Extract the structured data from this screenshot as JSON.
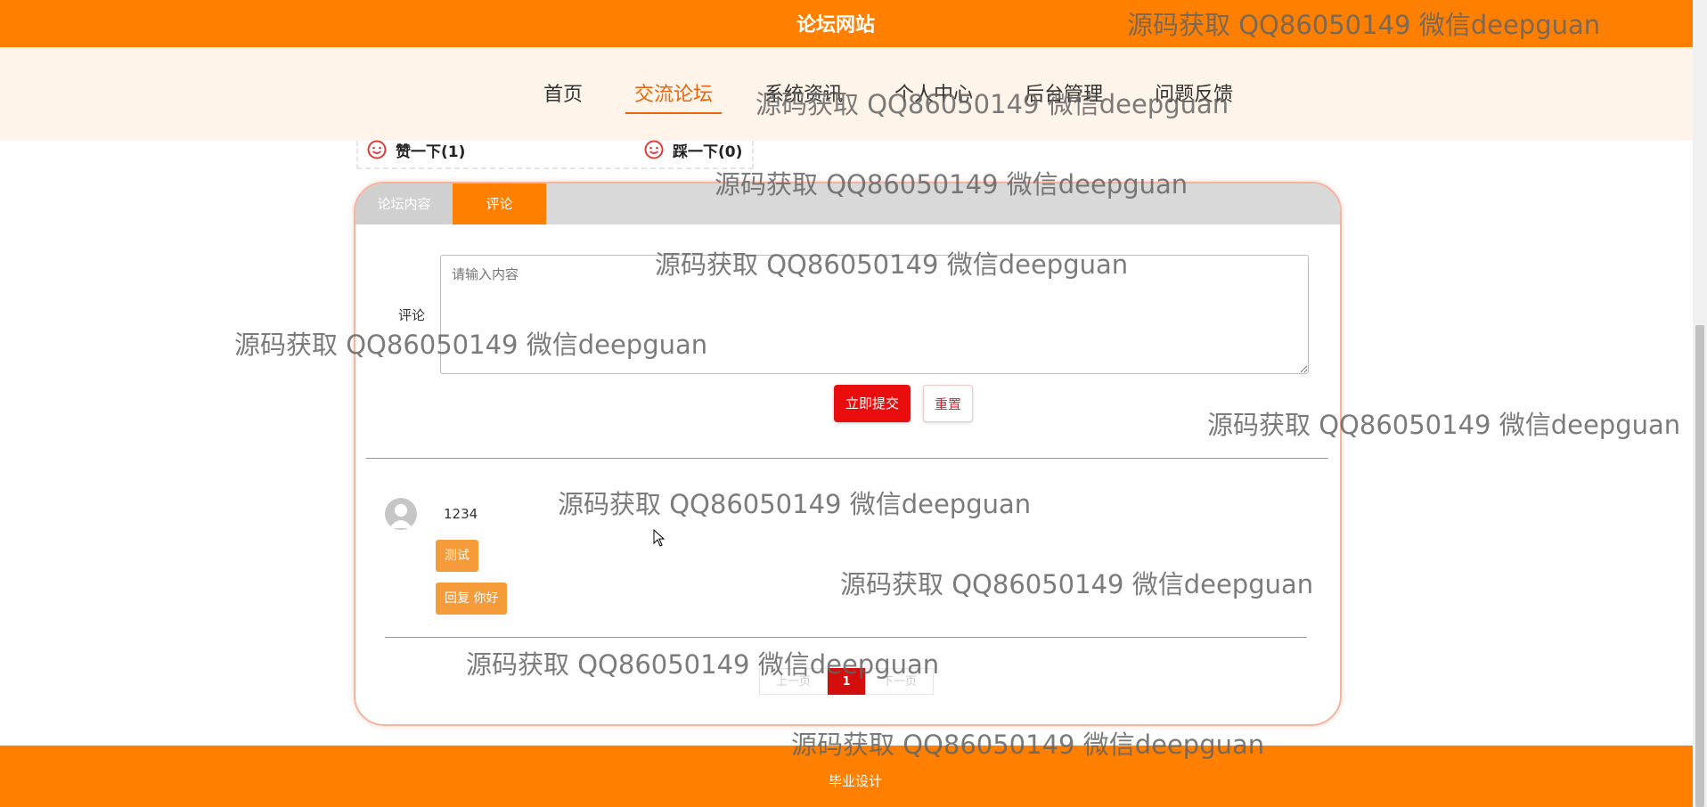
{
  "header": {
    "site_title": "论坛网站"
  },
  "nav": {
    "items": [
      {
        "label": "首页",
        "active": false
      },
      {
        "label": "交流论坛",
        "active": true
      },
      {
        "label": "系统资讯",
        "active": false
      },
      {
        "label": "个人中心",
        "active": false
      },
      {
        "label": "后台管理",
        "active": false
      },
      {
        "label": "问题反馈",
        "active": false
      }
    ]
  },
  "votes": {
    "like_label": "赞一下(1)",
    "dislike_label": "踩一下(0)"
  },
  "tabs": {
    "content_label": "论坛内容",
    "comment_label": "评论",
    "active": "评论"
  },
  "comment_form": {
    "label": "评论",
    "placeholder": "请输入内容",
    "submit_label": "立即提交",
    "reset_label": "重置"
  },
  "comments": [
    {
      "user": "1234",
      "content": "测试",
      "reply": "回复 你好"
    }
  ],
  "pagination": {
    "prev_label": "上一页",
    "current_page": "1",
    "next_label": "下一页"
  },
  "footer": {
    "text": "毕业设计"
  },
  "watermark": {
    "text": "源码获取 QQ86050149 微信deepguan"
  },
  "colors": {
    "primary": "#ff7f00",
    "nav_band": "#fef4ea",
    "active_nav": "#e8670e",
    "submit": "#ea0d0d",
    "chip": "#f59b3a"
  }
}
